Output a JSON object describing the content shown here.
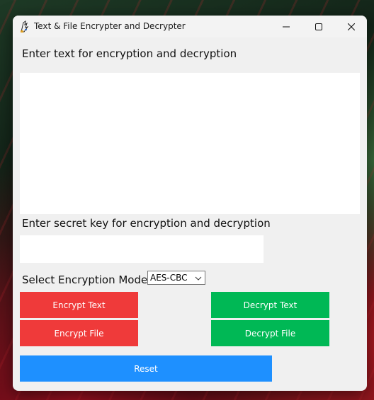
{
  "window": {
    "title": "Text & File Encrypter and Decrypter",
    "icon": "python-feather-icon"
  },
  "controls": {
    "minimize_icon": "minimize-icon",
    "maximize_icon": "maximize-icon",
    "close_icon": "close-icon"
  },
  "main": {
    "text_label": "Enter text for encryption and decryption",
    "text_value": "",
    "key_label": "Enter secret key for encryption and decryption",
    "key_value": "",
    "mode_label": "Select Encryption Mode:",
    "mode_selected": "AES-CBC",
    "encrypt_text_label": "Encrypt Text",
    "decrypt_text_label": "Decrypt Text",
    "encrypt_file_label": "Encrypt File",
    "decrypt_file_label": "Decrypt File",
    "reset_label": "Reset"
  },
  "colors": {
    "encrypt": "#ef3a3a",
    "decrypt": "#00b855",
    "reset": "#1e90ff",
    "window_bg": "#f0f0f0"
  }
}
